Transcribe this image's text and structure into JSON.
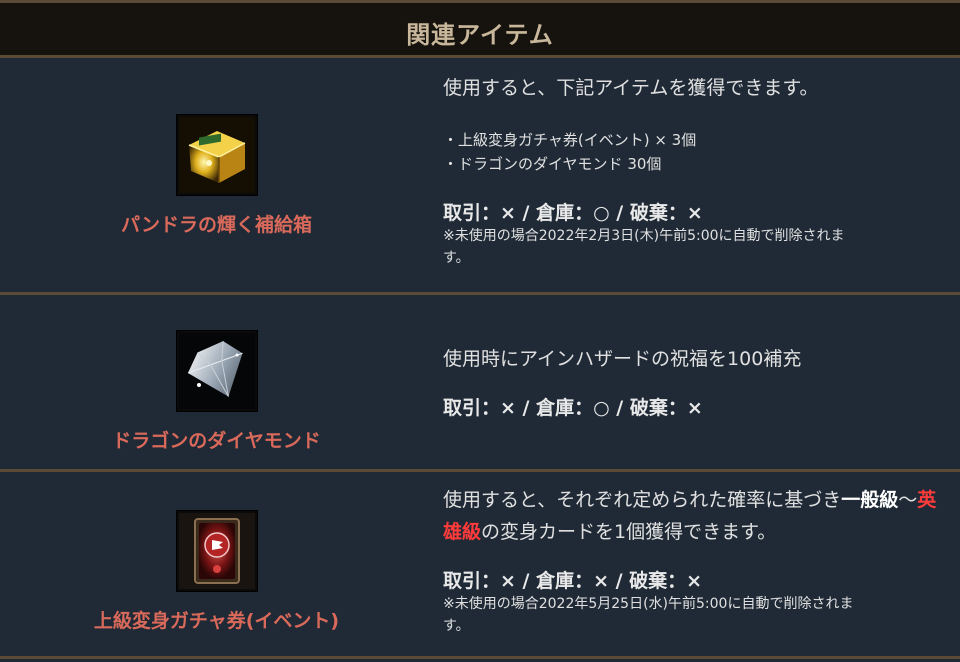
{
  "header": {
    "title": "関連アイテム"
  },
  "items": [
    {
      "name": "パンドラの輝く補給箱",
      "icon": "treasure-chest-icon",
      "description": "使用すると、下記アイテムを獲得できます。",
      "contents": [
        "・上級変身ガチャ券(イベント) × 3個",
        "・ドラゴンのダイヤモンド 30個"
      ],
      "trade": "取引：× / 倉庫：○ / 破棄：×",
      "note_line1": "※未使用の場合2022年2月3日(木)午前5:00に自動で削除されま",
      "note_line2": "す。"
    },
    {
      "name": "ドラゴンのダイヤモンド",
      "icon": "diamond-icon",
      "description": "使用時にアインハザードの祝福を100補充",
      "trade": "取引：× / 倉庫：○ / 破棄：×"
    },
    {
      "name": "上級変身ガチャ券(イベント)",
      "icon": "transform-card-icon",
      "desc_part1": "使用すると、それぞれ定められた確率に基づき",
      "desc_bold": "一般級",
      "desc_part2": "〜",
      "desc_hero": "英雄級",
      "desc_part3": "の変身カードを1個獲得できます。",
      "trade": "取引：× / 倉庫：× / 破棄：×",
      "note_line1": "※未使用の場合2022年5月25日(水)午前5:00に自動で削除されま",
      "note_line2": "す。"
    }
  ]
}
